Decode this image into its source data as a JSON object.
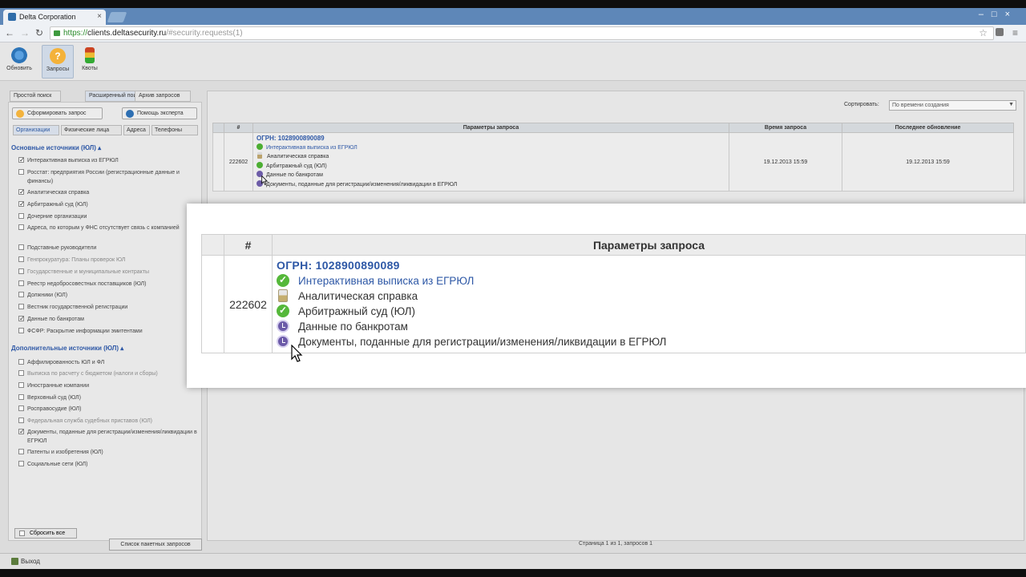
{
  "browser": {
    "tab_title": "Delta Corporation",
    "tab_close": "×",
    "window_controls": "–□×",
    "url_https": "https://",
    "url_host": "clients.deltasecurity.ru",
    "url_path": "/#security.requests(1)"
  },
  "toolbar": {
    "refresh_label": "Обновить",
    "requests_label": "Запросы",
    "quotas_label": "Квоты"
  },
  "search_tabs": [
    "Простой поиск",
    "Расширенный поиск",
    "Архив запросов"
  ],
  "left": {
    "form_request_button": "Сформировать запрос",
    "expert_help_button": "Помощь эксперта",
    "entity_tabs": [
      "Организации",
      "Физические лица",
      "Адреса",
      "Телефоны"
    ],
    "main_sources_title": "Основные источники (ЮЛ) ▴",
    "main_sources": [
      {
        "label": "Интерактивная выписка из ЕГРЮЛ",
        "checked": true
      },
      {
        "label": "Росстат: предприятия России (регистрационные данные и финансы)",
        "checked": false
      },
      {
        "label": "Аналитическая справка",
        "checked": true
      },
      {
        "label": "Арбитражный суд (ЮЛ)",
        "checked": true
      },
      {
        "label": "Дочерние организации",
        "checked": false
      },
      {
        "label": "Адреса, по которым у ФНС отсутствует связь с компанией",
        "checked": false
      },
      {
        "label": "Подставные руководители",
        "checked": false
      },
      {
        "label": "Генпрокуратура: Планы проверок ЮЛ",
        "checked": false,
        "dim": true
      },
      {
        "label": "Государственные и муниципальные контракты",
        "checked": false,
        "dim": true
      },
      {
        "label": "Реестр недобросовестных поставщиков (ЮЛ)",
        "checked": false
      },
      {
        "label": "Должники (ЮЛ)",
        "checked": false
      },
      {
        "label": "Вестник государственной регистрации",
        "checked": false
      },
      {
        "label": "Данные по банкротам",
        "checked": true
      },
      {
        "label": "ФСФР: Раскрытие информации эмитентами",
        "checked": false
      }
    ],
    "extra_sources_title": "Дополнительные источники (ЮЛ) ▴",
    "extra_sources": [
      {
        "label": "Аффилированность ЮЛ и ФЛ",
        "checked": false
      },
      {
        "label": "Выписка по расчету с бюджетом (налоги и сборы)",
        "checked": false,
        "dim": true
      },
      {
        "label": "Иностранные компании",
        "checked": false
      },
      {
        "label": "Верховный суд (ЮЛ)",
        "checked": false
      },
      {
        "label": "Росправосудие (ЮЛ)",
        "checked": false
      },
      {
        "label": "Федеральная служба судебных приставов (ЮЛ)",
        "checked": false,
        "dim": true
      },
      {
        "label": "Документы, поданные для регистрации/изменения/ликвидации в ЕГРЮЛ",
        "checked": true
      },
      {
        "label": "Патенты и изобретения (ЮЛ)",
        "checked": false
      },
      {
        "label": "Социальные сети (ЮЛ)",
        "checked": false
      }
    ],
    "reset_all": "Сбросить все",
    "batch_list_button": "Список пакетных запросов"
  },
  "right": {
    "sort_label": "Сортировать:",
    "sort_value": "По времени создания",
    "columns": [
      "#",
      "Параметры запроса",
      "Время запроса",
      "Последнее обновление"
    ],
    "rows": [
      {
        "id": "222602",
        "ogrn": "ОГРН: 1028900890089",
        "items": [
          {
            "status": "ok",
            "label": "Интерактивная выписка из ЕГРЮЛ",
            "link": true
          },
          {
            "status": "wait",
            "label": "Аналитическая справка",
            "link": false
          },
          {
            "status": "ok",
            "label": "Арбитражный суд (ЮЛ)",
            "link": false
          },
          {
            "status": "clock",
            "label": "Данные по банкротам",
            "link": false
          },
          {
            "status": "clock",
            "label": "Документы, поданные для регистрации/изменения/ликвидации в ЕГРЮЛ",
            "link": false
          }
        ],
        "request_time": "19.12.2013 15:59",
        "last_update": "19.12.2013 15:59"
      }
    ],
    "pager": "Страница 1 из 1, запросов 1"
  },
  "status": {
    "logout": "Выход"
  },
  "icons": {
    "ok": "check-circle-icon",
    "wait": "hourglass-icon",
    "clock": "clock-icon"
  },
  "colors": {
    "accent_blue": "#2e58a6",
    "ok_green": "#55b83a",
    "pending_purple": "#6b5aa8",
    "titlebar": "#5e87b8"
  }
}
